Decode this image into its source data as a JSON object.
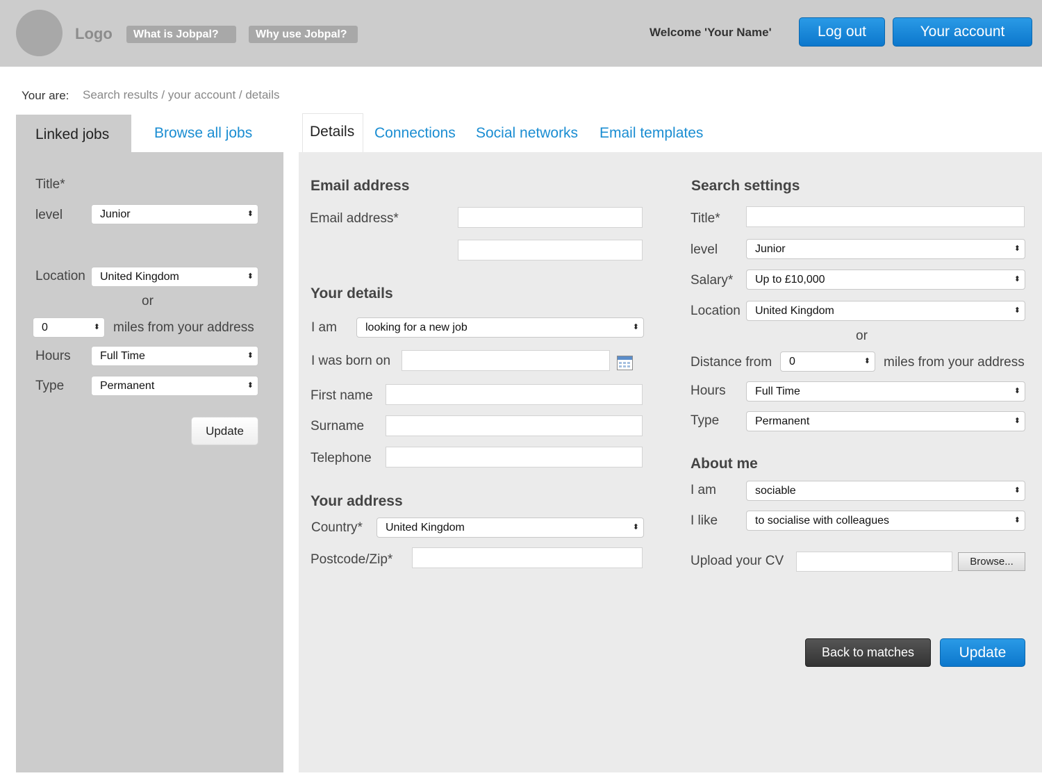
{
  "header": {
    "logo": "Logo",
    "nav": [
      "What is Jobpal?",
      "Why use Jobpal?"
    ],
    "welcome": "Welcome 'Your Name'",
    "logout": "Log out",
    "account": "Your account"
  },
  "breadcrumb": {
    "label": "Your are:",
    "path": "Search results / your account / details"
  },
  "left": {
    "tabs": [
      "Linked jobs",
      "Browse all jobs"
    ],
    "title_label": "Title*",
    "level_label": "level",
    "level_value": "Junior",
    "location_label": "Location",
    "location_value": "United Kingdom",
    "or": "or",
    "miles_value": "0",
    "miles_label": "miles from your address",
    "hours_label": "Hours",
    "hours_value": "Full Time",
    "type_label": "Type",
    "type_value": "Permanent",
    "update": "Update"
  },
  "tabs": [
    "Details",
    "Connections",
    "Social networks",
    "Email templates"
  ],
  "email": {
    "heading": "Email address",
    "label": "Email address*"
  },
  "details": {
    "heading": "Your details",
    "i_am_label": "I am",
    "i_am_value": "looking for a new job",
    "born_label": "I was born on",
    "first_name": "First name",
    "surname": "Surname",
    "telephone": "Telephone"
  },
  "address": {
    "heading": "Your address",
    "country_label": "Country*",
    "country_value": "United Kingdom",
    "postcode_label": "Postcode/Zip*"
  },
  "search": {
    "heading": "Search settings",
    "title_label": "Title*",
    "level_label": "level",
    "level_value": "Junior",
    "salary_label": "Salary*",
    "salary_value": "Up to £10,000",
    "location_label": "Location",
    "location_value": "United Kingdom",
    "or": "or",
    "distance_label": "Distance from",
    "distance_value": "0",
    "miles_label": "miles from your address",
    "hours_label": "Hours",
    "hours_value": "Full Time",
    "type_label": "Type",
    "type_value": "Permanent"
  },
  "about": {
    "heading": "About me",
    "i_am_label": "I am",
    "i_am_value": "sociable",
    "i_like_label": "I like",
    "i_like_value": "to socialise with colleagues",
    "upload_label": "Upload your CV",
    "browse": "Browse..."
  },
  "actions": {
    "back": "Back to matches",
    "update": "Update"
  }
}
